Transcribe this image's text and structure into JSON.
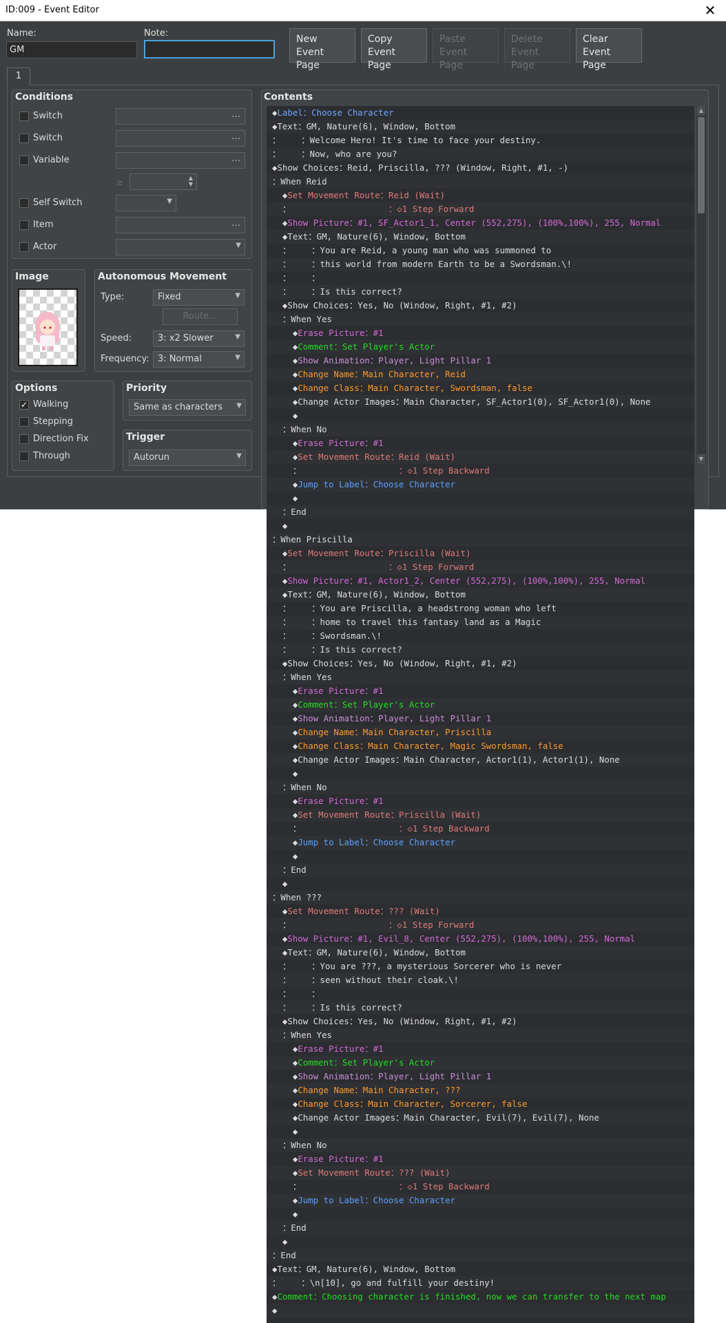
{
  "window": {
    "title": "ID:009 - Event Editor",
    "close_glyph": "✕"
  },
  "name": {
    "label": "Name:",
    "value": "GM"
  },
  "note": {
    "label": "Note:",
    "value": ""
  },
  "toolbar": {
    "new": "New\nEvent Page",
    "copy": "Copy\nEvent Page",
    "paste": "Paste\nEvent Page",
    "delete": "Delete\nEvent Page",
    "clear": "Clear\nEvent Page"
  },
  "tab": {
    "label": "1"
  },
  "conditions": {
    "title": "Conditions",
    "switch1": "Switch",
    "switch2": "Switch",
    "variable": "Variable",
    "ge": "≥",
    "self_switch": "Self Switch",
    "item": "Item",
    "actor": "Actor",
    "dots": "…"
  },
  "image": {
    "title": "Image"
  },
  "autonomous": {
    "title": "Autonomous Movement",
    "type_label": "Type:",
    "type_value": "Fixed",
    "route_button": "Route...",
    "speed_label": "Speed:",
    "speed_value": "3: x2 Slower",
    "freq_label": "Frequency:",
    "freq_value": "3: Normal"
  },
  "options": {
    "title": "Options",
    "walking": "Walking",
    "stepping": "Stepping",
    "direction_fix": "Direction Fix",
    "through": "Through",
    "walking_checked": "✓"
  },
  "priority": {
    "title": "Priority",
    "value": "Same as characters"
  },
  "trigger": {
    "title": "Trigger",
    "value": "Autorun"
  },
  "contents": {
    "title": "Contents"
  },
  "colors": {
    "default": "#dcdcdc",
    "label": "#6fa8ff",
    "move": "#e07a7a",
    "picture": "#d36bd6",
    "comment": "#22dd22",
    "change": "#ff9a2e",
    "jump": "#5aa0ff",
    "anim": "#c98fd8"
  },
  "commands": [
    [
      {
        "t": "◆"
      },
      {
        "t": "Label",
        "c": "label"
      },
      {
        "t": "：Choose Character",
        "c": "label"
      }
    ],
    [
      {
        "t": "◆Text：GM, Nature(6), Window, Bottom"
      }
    ],
    [
      {
        "t": "：    ：Welcome Hero! It's time to face your destiny."
      }
    ],
    [
      {
        "t": "：    ：Now, who are you?"
      }
    ],
    [
      {
        "t": "◆Show Choices：Reid, Priscilla, ??? (Window, Right, #1, -)"
      }
    ],
    [
      {
        "t": "：When Reid"
      }
    ],
    [
      {
        "t": "  ◆"
      },
      {
        "t": "Set Movement Route：Reid (Wait)",
        "c": "move"
      }
    ],
    [
      {
        "t": "  ：                   "
      },
      {
        "t": "：◇1 Step Forward",
        "c": "move"
      }
    ],
    [
      {
        "t": "  ◆"
      },
      {
        "t": "Show Picture：#1, SF_Actor1_1, Center (552,275), (100%,100%), 255, Normal",
        "c": "picture"
      }
    ],
    [
      {
        "t": "  ◆Text：GM, Nature(6), Window, Bottom"
      }
    ],
    [
      {
        "t": "  ：    ：You are Reid, a young man who was summoned to"
      }
    ],
    [
      {
        "t": "  ：    ：this world from modern Earth to be a Swordsman.\\!"
      }
    ],
    [
      {
        "t": "  ：    ："
      }
    ],
    [
      {
        "t": "  ：    ：Is this correct?"
      }
    ],
    [
      {
        "t": "  ◆Show Choices：Yes, No (Window, Right, #1, #2)"
      }
    ],
    [
      {
        "t": "  ：When Yes"
      }
    ],
    [
      {
        "t": "    ◆"
      },
      {
        "t": "Erase Picture：#1",
        "c": "picture"
      }
    ],
    [
      {
        "t": "    ◆"
      },
      {
        "t": "Comment：Set Player's Actor",
        "c": "comment"
      }
    ],
    [
      {
        "t": "    ◆"
      },
      {
        "t": "Show Animation：Player, Light Pillar 1",
        "c": "anim"
      }
    ],
    [
      {
        "t": "    ◆"
      },
      {
        "t": "Change Name：Main Character, Reid",
        "c": "change"
      }
    ],
    [
      {
        "t": "    ◆"
      },
      {
        "t": "Change Class：Main Character, Swordsman, false",
        "c": "change"
      }
    ],
    [
      {
        "t": "    ◆Change Actor Images：Main Character, SF_Actor1(0), SF_Actor1(0), None"
      }
    ],
    [
      {
        "t": "    ◆"
      }
    ],
    [
      {
        "t": "  ：When No"
      }
    ],
    [
      {
        "t": "    ◆"
      },
      {
        "t": "Erase Picture：#1",
        "c": "picture"
      }
    ],
    [
      {
        "t": "    ◆"
      },
      {
        "t": "Set Movement Route：Reid (Wait)",
        "c": "move"
      }
    ],
    [
      {
        "t": "    ：                   "
      },
      {
        "t": "：◇1 Step Backward",
        "c": "move"
      }
    ],
    [
      {
        "t": "    ◆"
      },
      {
        "t": "Jump to Label：Choose Character",
        "c": "jump"
      }
    ],
    [
      {
        "t": "    ◆"
      }
    ],
    [
      {
        "t": "  ：End"
      }
    ],
    [
      {
        "t": "  ◆"
      }
    ],
    [
      {
        "t": "：When Priscilla"
      }
    ],
    [
      {
        "t": "  ◆"
      },
      {
        "t": "Set Movement Route：Priscilla (Wait)",
        "c": "move"
      }
    ],
    [
      {
        "t": "  ：                   "
      },
      {
        "t": "：◇1 Step Forward",
        "c": "move"
      }
    ],
    [
      {
        "t": "  ◆"
      },
      {
        "t": "Show Picture：#1, Actor1_2, Center (552,275), (100%,100%), 255, Normal",
        "c": "picture"
      }
    ],
    [
      {
        "t": "  ◆Text：GM, Nature(6), Window, Bottom"
      }
    ],
    [
      {
        "t": "  ：    ：You are Priscilla, a headstrong woman who left"
      }
    ],
    [
      {
        "t": "  ：    ：home to travel this fantasy land as a Magic"
      }
    ],
    [
      {
        "t": "  ：    ：Swordsman.\\!"
      }
    ],
    [
      {
        "t": "  ：    ：Is this correct?"
      }
    ],
    [
      {
        "t": "  ◆Show Choices：Yes, No (Window, Right, #1, #2)"
      }
    ],
    [
      {
        "t": "  ：When Yes"
      }
    ],
    [
      {
        "t": "    ◆"
      },
      {
        "t": "Erase Picture：#1",
        "c": "picture"
      }
    ],
    [
      {
        "t": "    ◆"
      },
      {
        "t": "Comment：Set Player's Actor",
        "c": "comment"
      }
    ],
    [
      {
        "t": "    ◆"
      },
      {
        "t": "Show Animation：Player, Light Pillar 1",
        "c": "anim"
      }
    ],
    [
      {
        "t": "    ◆"
      },
      {
        "t": "Change Name：Main Character, Priscilla",
        "c": "change"
      }
    ],
    [
      {
        "t": "    ◆"
      },
      {
        "t": "Change Class：Main Character, Magic Swordsman, false",
        "c": "change"
      }
    ],
    [
      {
        "t": "    ◆Change Actor Images：Main Character, Actor1(1), Actor1(1), None"
      }
    ],
    [
      {
        "t": "    ◆"
      }
    ],
    [
      {
        "t": "  ：When No"
      }
    ],
    [
      {
        "t": "    ◆"
      },
      {
        "t": "Erase Picture：#1",
        "c": "picture"
      }
    ],
    [
      {
        "t": "    ◆"
      },
      {
        "t": "Set Movement Route：Priscilla (Wait)",
        "c": "move"
      }
    ],
    [
      {
        "t": "    ：                   "
      },
      {
        "t": "：◇1 Step Backward",
        "c": "move"
      }
    ],
    [
      {
        "t": "    ◆"
      },
      {
        "t": "Jump to Label：Choose Character",
        "c": "jump"
      }
    ],
    [
      {
        "t": "    ◆"
      }
    ],
    [
      {
        "t": "  ：End"
      }
    ],
    [
      {
        "t": "  ◆"
      }
    ],
    [
      {
        "t": "：When ???"
      }
    ],
    [
      {
        "t": "  ◆"
      },
      {
        "t": "Set Movement Route：??? (Wait)",
        "c": "move"
      }
    ],
    [
      {
        "t": "  ：                   "
      },
      {
        "t": "：◇1 Step Forward",
        "c": "move"
      }
    ],
    [
      {
        "t": "  ◆"
      },
      {
        "t": "Show Picture：#1, Evil_8, Center (552,275), (100%,100%), 255, Normal",
        "c": "picture"
      }
    ],
    [
      {
        "t": "  ◆Text：GM, Nature(6), Window, Bottom"
      }
    ],
    [
      {
        "t": "  ：    ：You are ???, a mysterious Sorcerer who is never"
      }
    ],
    [
      {
        "t": "  ：    ：seen without their cloak.\\!"
      }
    ],
    [
      {
        "t": "  ：    ："
      }
    ],
    [
      {
        "t": "  ：    ：Is this correct?"
      }
    ],
    [
      {
        "t": "  ◆Show Choices：Yes, No (Window, Right, #1, #2)"
      }
    ],
    [
      {
        "t": "  ：When Yes"
      }
    ],
    [
      {
        "t": "    ◆"
      },
      {
        "t": "Erase Picture：#1",
        "c": "picture"
      }
    ],
    [
      {
        "t": "    ◆"
      },
      {
        "t": "Comment：Set Player's Actor",
        "c": "comment"
      }
    ],
    [
      {
        "t": "    ◆"
      },
      {
        "t": "Show Animation：Player, Light Pillar 1",
        "c": "anim"
      }
    ],
    [
      {
        "t": "    ◆"
      },
      {
        "t": "Change Name：Main Character, ???",
        "c": "change"
      }
    ],
    [
      {
        "t": "    ◆"
      },
      {
        "t": "Change Class：Main Character, Sorcerer, false",
        "c": "change"
      }
    ],
    [
      {
        "t": "    ◆Change Actor Images：Main Character, Evil(7), Evil(7), None"
      }
    ],
    [
      {
        "t": "    ◆"
      }
    ],
    [
      {
        "t": "  ：When No"
      }
    ],
    [
      {
        "t": "    ◆"
      },
      {
        "t": "Erase Picture：#1",
        "c": "picture"
      }
    ],
    [
      {
        "t": "    ◆"
      },
      {
        "t": "Set Movement Route：??? (Wait)",
        "c": "move"
      }
    ],
    [
      {
        "t": "    ：                   "
      },
      {
        "t": "：◇1 Step Backward",
        "c": "move"
      }
    ],
    [
      {
        "t": "    ◆"
      },
      {
        "t": "Jump to Label：Choose Character",
        "c": "jump"
      }
    ],
    [
      {
        "t": "    ◆"
      }
    ],
    [
      {
        "t": "  ：End"
      }
    ],
    [
      {
        "t": "  ◆"
      }
    ],
    [
      {
        "t": "：End"
      }
    ],
    [
      {
        "t": "◆Text：GM, Nature(6), Window, Bottom"
      }
    ],
    [
      {
        "t": "：    ：\\n[10], go and fulfill your destiny!"
      }
    ],
    [
      {
        "t": "◆"
      },
      {
        "t": "Comment：Choosing character is finished, now we can transfer to the next map",
        "c": "comment"
      }
    ],
    [
      {
        "t": "◆"
      }
    ]
  ]
}
